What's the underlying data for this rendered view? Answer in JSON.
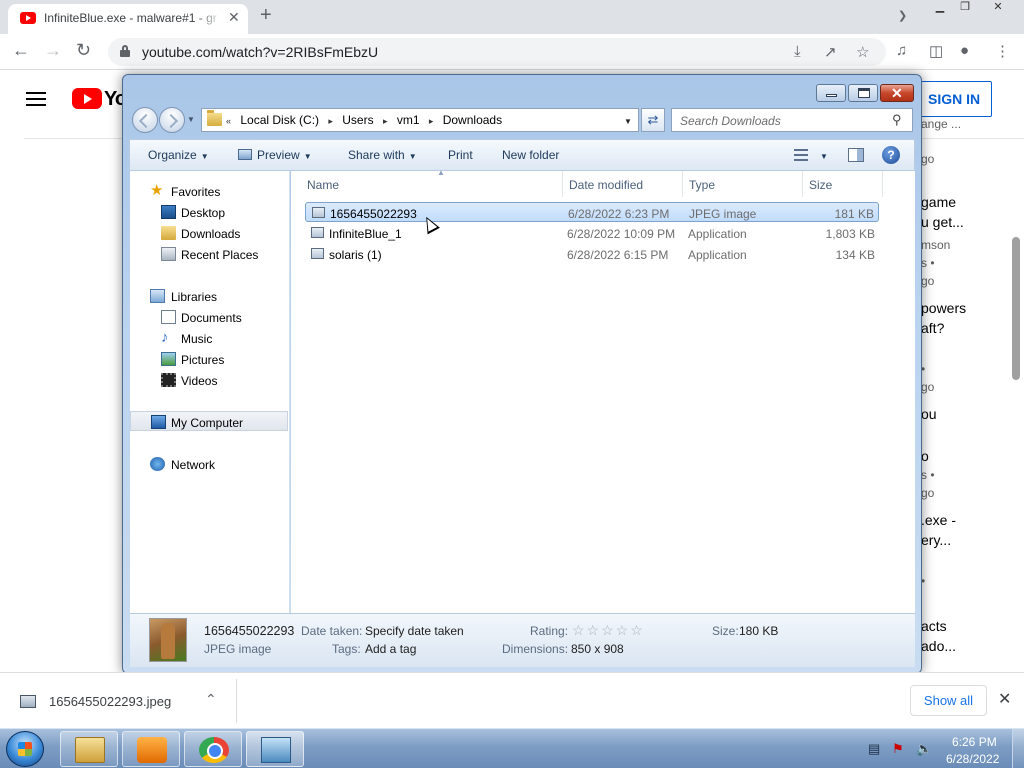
{
  "browser": {
    "tab_title": "InfiniteBlue.exe - malware#1 - gr",
    "tab_close": "✕",
    "new_tab": "+",
    "url": "youtube.com/watch?v=2RIBsFmEbzU"
  },
  "youtube": {
    "logo_text": "Yo",
    "sign_in": "SIGN IN",
    "sidebar_fragments": [
      {
        "text": "ange ...",
        "style": "meta"
      },
      {
        "text": "go",
        "style": "meta"
      },
      {
        "text": "game",
        "style": "title"
      },
      {
        "text": "u get...",
        "style": "title"
      },
      {
        "text": "mson",
        "style": "meta"
      },
      {
        "text": "s •",
        "style": "meta"
      },
      {
        "text": "go",
        "style": "meta"
      },
      {
        "text": "powers",
        "style": "title"
      },
      {
        "text": "aft?",
        "style": "title"
      },
      {
        "text": "•",
        "style": "meta"
      },
      {
        "text": "go",
        "style": "meta"
      },
      {
        "text": "ou",
        "style": "title"
      },
      {
        "text": "o",
        "style": "title"
      },
      {
        "text": "s •",
        "style": "meta"
      },
      {
        "text": "go",
        "style": "meta"
      },
      {
        "text": ".exe -",
        "style": "title"
      },
      {
        "text": "ery...",
        "style": "title"
      },
      {
        "text": "•",
        "style": "meta"
      },
      {
        "text": "acts",
        "style": "title"
      },
      {
        "text": "ado...",
        "style": "title"
      }
    ]
  },
  "explorer": {
    "breadcrumbs": [
      "Local Disk (C:)",
      "Users",
      "vm1",
      "Downloads"
    ],
    "search_placeholder": "Search Downloads",
    "commands": {
      "organize": "Organize",
      "preview": "Preview",
      "share_with": "Share with",
      "print": "Print",
      "new_folder": "New folder"
    },
    "nav": {
      "favorites": "Favorites",
      "desktop": "Desktop",
      "downloads": "Downloads",
      "recent_places": "Recent Places",
      "libraries": "Libraries",
      "documents": "Documents",
      "music": "Music",
      "pictures": "Pictures",
      "videos": "Videos",
      "my_computer": "My Computer",
      "network": "Network"
    },
    "columns": {
      "name": "Name",
      "date_modified": "Date modified",
      "type": "Type",
      "size": "Size"
    },
    "files": [
      {
        "name": "1656455022293",
        "date": "6/28/2022 6:23 PM",
        "type": "JPEG image",
        "size": "181 KB"
      },
      {
        "name": "InfiniteBlue_1",
        "date": "6/28/2022 10:09 PM",
        "type": "Application",
        "size": "1,803 KB"
      },
      {
        "name": "solaris (1)",
        "date": "6/28/2022 6:15 PM",
        "type": "Application",
        "size": "134 KB"
      }
    ],
    "details": {
      "filename": "1656455022293",
      "filetype": "JPEG image",
      "date_taken_label": "Date taken:",
      "date_taken_value": "Specify date taken",
      "tags_label": "Tags:",
      "tags_value": "Add a tag",
      "rating_label": "Rating:",
      "rating_stars": "☆☆☆☆☆",
      "dimensions_label": "Dimensions:",
      "dimensions_value": "850 x 908",
      "size_label": "Size:",
      "size_value": "180 KB"
    }
  },
  "downloads_shelf": {
    "item_name": "1656455022293.jpeg",
    "show_all": "Show all"
  },
  "taskbar": {
    "time": "6:26 PM",
    "date": "6/28/2022"
  }
}
